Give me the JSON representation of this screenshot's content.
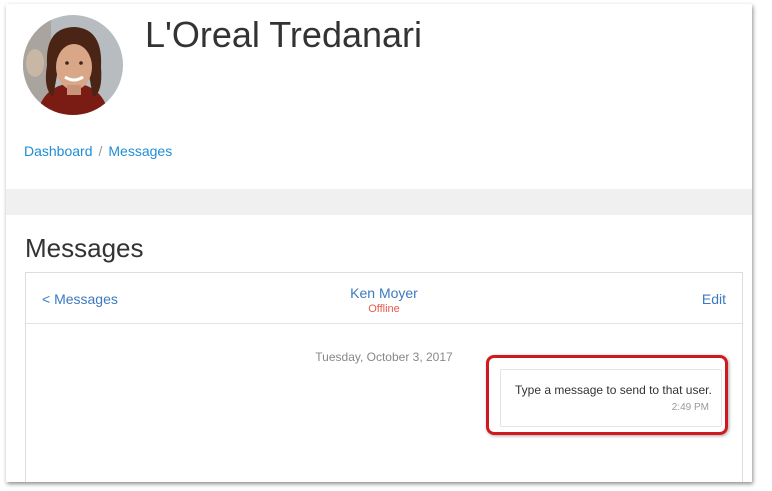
{
  "profile": {
    "name": "L'Oreal Tredanari",
    "avatar_icon": "user-photo"
  },
  "breadcrumb": {
    "items": [
      {
        "label": "Dashboard"
      },
      {
        "label": "Messages"
      }
    ],
    "separator": "/"
  },
  "page": {
    "title": "Messages"
  },
  "conversation": {
    "back_label": "< Messages",
    "contact_name": "Ken Moyer",
    "contact_status": "Offline",
    "edit_label": "Edit",
    "date": "Tuesday, October 3, 2017",
    "messages": [
      {
        "text": "Type a message to send to that user.",
        "time": "2:49 PM"
      }
    ]
  },
  "colors": {
    "link": "#1f8dd6",
    "status_offline": "#e35d4d",
    "highlight": "#d0191f"
  }
}
